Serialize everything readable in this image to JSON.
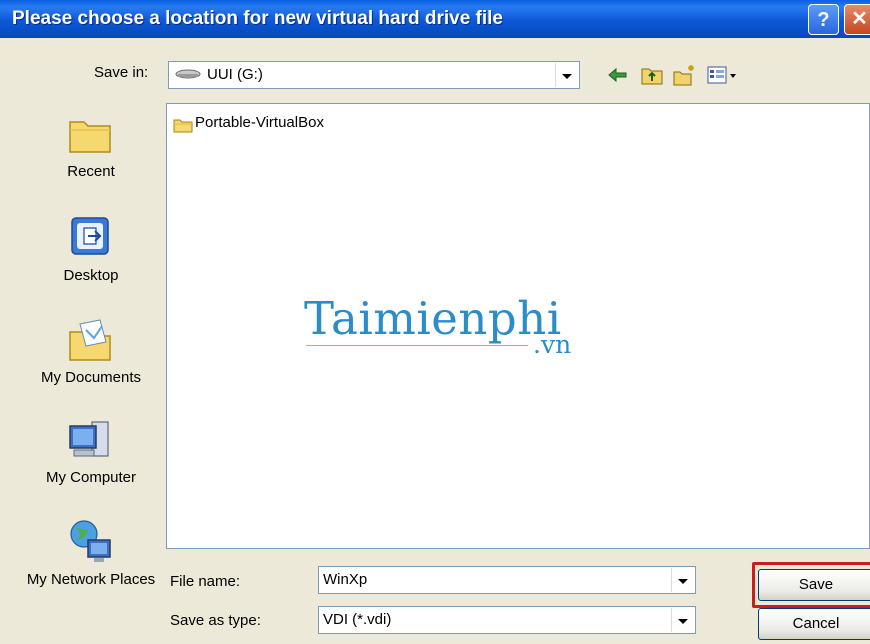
{
  "dialog": {
    "title": "Please choose a location for new virtual hard drive file",
    "help_glyph": "?",
    "close_glyph": "✕"
  },
  "toolbar": {
    "save_in_label": "Save in:",
    "location": "UUI (G:)",
    "icons": [
      "drive-icon",
      "back-arrow-icon",
      "up-folder-icon",
      "new-folder-icon",
      "view-menu-icon"
    ]
  },
  "places": [
    {
      "label": "Recent",
      "icon": "recent-folder-icon"
    },
    {
      "label": "Desktop",
      "icon": "desktop-icon"
    },
    {
      "label": "My Documents",
      "icon": "my-documents-icon"
    },
    {
      "label": "My Computer",
      "icon": "my-computer-icon"
    },
    {
      "label": "My Network Places",
      "icon": "network-places-icon"
    }
  ],
  "files": [
    {
      "name": "Portable-VirtualBox",
      "icon": "folder-icon"
    }
  ],
  "watermark": {
    "main": "Taimienphi",
    "sub": ".vn"
  },
  "form": {
    "file_name_label": "File name:",
    "file_name_value": "WinXp",
    "save_as_type_label": "Save as type:",
    "save_as_type_value": "VDI (*.vdi)"
  },
  "buttons": {
    "save": "Save",
    "cancel": "Cancel"
  },
  "colors": {
    "titlebar": "#0b58d8",
    "highlight": "#c81e1e",
    "watermark": "#2a8cc8"
  }
}
